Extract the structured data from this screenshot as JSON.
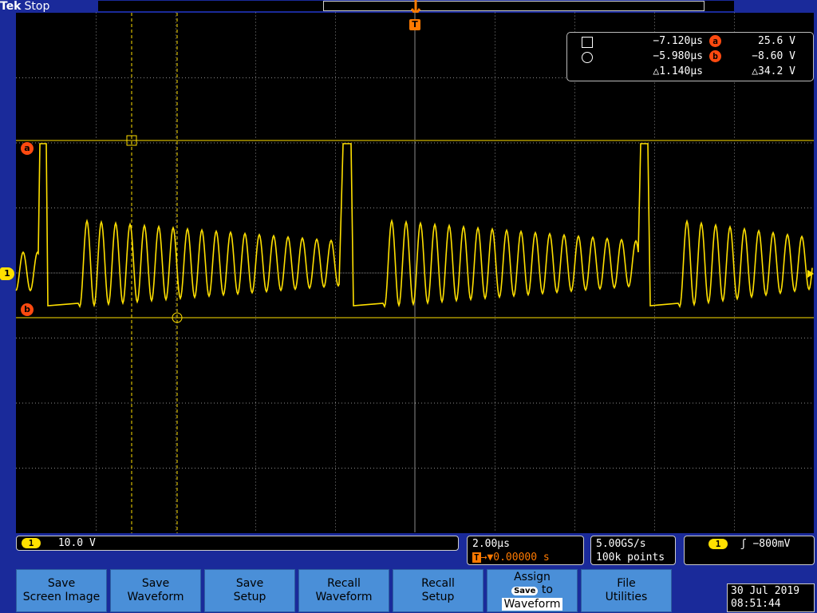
{
  "header": {
    "brand": "Tek",
    "status": "Stop",
    "trigger_marker": "T"
  },
  "colors": {
    "trace": "#ffe000",
    "cursor": "#ffe000",
    "accent": "#ff7a00",
    "grid": "#8a8a8a",
    "button": "#4a8fd8"
  },
  "cursor_readout": {
    "rows": [
      {
        "symbol": "square-icon",
        "time": "−7.120µs",
        "badge": "a",
        "volt": "25.6 V"
      },
      {
        "symbol": "circle-icon",
        "time": "−5.980µs",
        "badge": "b",
        "volt": "−8.60 V"
      },
      {
        "symbol": "",
        "time": "△1.140µs",
        "badge": "",
        "volt": "△34.2 V"
      }
    ]
  },
  "cursor_labels": {
    "a": "a",
    "b": "b"
  },
  "channel_marker": "1",
  "status_bar": {
    "channel": "1",
    "scale": "10.0 V",
    "timebase": "2.00µs",
    "trigger_pos_icon": "T",
    "trigger_pos": "→▼0.00000 s",
    "sample_rate": "5.00GS/s",
    "record_length": "100k points",
    "trigger_channel": "1",
    "trigger_edge": "ʃ",
    "trigger_level": "−800mV"
  },
  "buttons": [
    {
      "line1": "Save",
      "line2": "Screen Image"
    },
    {
      "line1": "Save",
      "line2": "Waveform"
    },
    {
      "line1": "Save",
      "line2": "Setup"
    },
    {
      "line1": "Recall",
      "line2": "Waveform"
    },
    {
      "line1": "Recall",
      "line2": "Setup"
    },
    {
      "line1": "Assign",
      "badge": "Save",
      "to": "to",
      "line2": "Waveform"
    },
    {
      "line1": "File",
      "line2": "Utilities"
    }
  ],
  "datetime": {
    "date": "30 Jul  2019",
    "time": "08:51:44"
  }
}
